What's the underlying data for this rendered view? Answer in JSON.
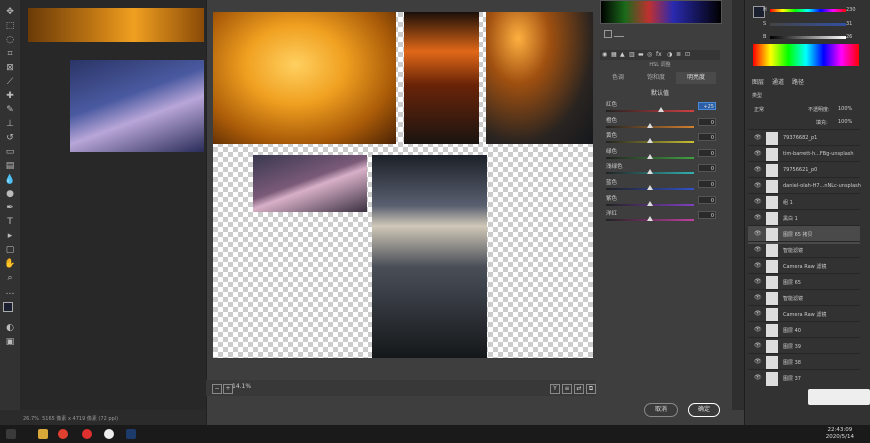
{
  "status_bar": {
    "zoom": "26.7%",
    "doc_info": "5165 像素 x 4719 像素 (72 ppi)"
  },
  "dialog": {
    "tabs": [
      "色调",
      "饱和度",
      "明亮度"
    ],
    "active_tab": "明亮度",
    "panel_header": "HSL 调整",
    "subtitle": "默认值",
    "sliders": [
      {
        "label": "红色",
        "value": "+25",
        "pos": 0.62,
        "color": "#d04040",
        "highlight": true
      },
      {
        "label": "橙色",
        "value": "0",
        "pos": 0.5,
        "color": "#d08030",
        "highlight": false
      },
      {
        "label": "黄色",
        "value": "0",
        "pos": 0.5,
        "color": "#c8c030",
        "highlight": false
      },
      {
        "label": "绿色",
        "value": "0",
        "pos": 0.5,
        "color": "#40a040",
        "highlight": false
      },
      {
        "label": "浅绿色",
        "value": "0",
        "pos": 0.5,
        "color": "#30b0b0",
        "highlight": false
      },
      {
        "label": "蓝色",
        "value": "0",
        "pos": 0.5,
        "color": "#3050c8",
        "highlight": false
      },
      {
        "label": "紫色",
        "value": "0",
        "pos": 0.5,
        "color": "#8040c0",
        "highlight": false
      },
      {
        "label": "洋红",
        "value": "0",
        "pos": 0.5,
        "color": "#c040a0",
        "highlight": false
      }
    ],
    "zoom_value": "14.1%",
    "cancel_label": "取消",
    "ok_label": "确定"
  },
  "color_panel": {
    "labels": [
      "H",
      "S",
      "B"
    ],
    "values": [
      "230",
      "31",
      "26"
    ]
  },
  "layers_panel": {
    "tabs": [
      "图层",
      "通道",
      "路径"
    ],
    "filter_label": "类型",
    "blend_mode": "正常",
    "opacity_label": "不透明度:",
    "opacity_value": "100%",
    "fill_label": "填充:",
    "fill_value": "100%",
    "layers": [
      {
        "name": "79376682_p1",
        "selected": false
      },
      {
        "name": "tim-barrett-h...FBg-unsplash",
        "selected": false
      },
      {
        "name": "79756621_p0",
        "selected": false
      },
      {
        "name": "daniel-olah-H7...nNLc-unsplash",
        "selected": false
      },
      {
        "name": "组 1",
        "selected": false
      },
      {
        "name": "黑白 1",
        "selected": false
      },
      {
        "name": "图层 65 拷贝",
        "selected": true
      },
      {
        "name": "智能滤镜",
        "selected": false
      },
      {
        "name": "Camera Raw 滤镜",
        "selected": false
      },
      {
        "name": "图层 65",
        "selected": false
      },
      {
        "name": "智能滤镜",
        "selected": false
      },
      {
        "name": "Camera Raw 滤镜",
        "selected": false
      },
      {
        "name": "图层 40",
        "selected": false
      },
      {
        "name": "图层 39",
        "selected": false
      },
      {
        "name": "图层 38",
        "selected": false
      },
      {
        "name": "图层 37",
        "selected": false
      }
    ]
  },
  "taskbar": {
    "time": "22:43:09",
    "date": "2020/5/14"
  }
}
